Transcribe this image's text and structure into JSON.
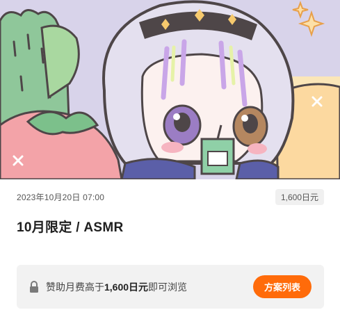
{
  "post": {
    "date": "2023年10月20日 07:00",
    "price": "1,600日元",
    "title": "10月限定 / ASMR"
  },
  "lock": {
    "text_prefix": "赞助月费高于",
    "text_amount": "1,600日元",
    "text_suffix": "即可浏览",
    "icon": "lock-icon"
  },
  "actions": {
    "plan_list_label": "方案列表"
  },
  "colors": {
    "accent": "#ff6b0a",
    "panel": "#f2f2f2"
  }
}
